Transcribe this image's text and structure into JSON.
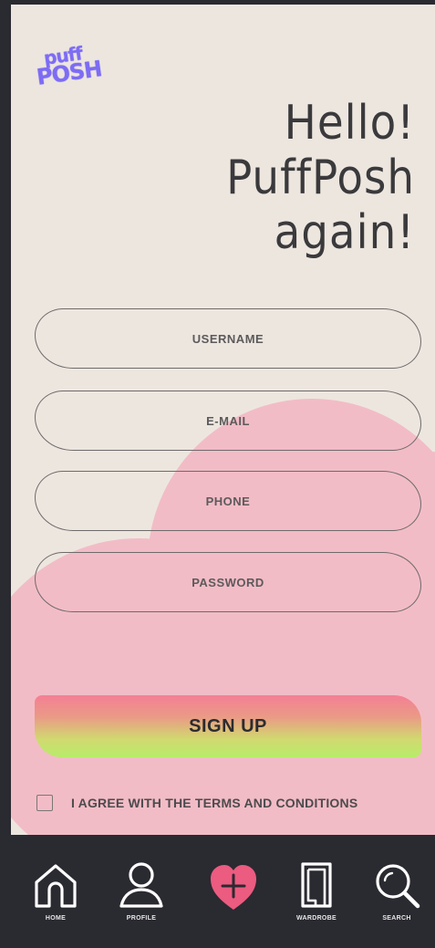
{
  "app": {
    "logo_line1": "puff",
    "logo_line2": "POSH"
  },
  "header": {
    "title_line1": "Hello!",
    "title_line2": "PuffPosh",
    "title_line3": "again!"
  },
  "form": {
    "username_placeholder": "USERNAME",
    "email_placeholder": "E-MAIL",
    "phone_placeholder": "PHONE",
    "password_placeholder": "PASSWORD",
    "submit_label": "SIGN UP",
    "terms_label": "I AGREE WITH THE TERMS AND CONDITIONS",
    "terms_checked": false
  },
  "nav": {
    "items": [
      {
        "label": "HOME",
        "icon": "home-icon"
      },
      {
        "label": "PROFILE",
        "icon": "profile-icon"
      },
      {
        "label": "",
        "icon": "add-heart-icon"
      },
      {
        "label": "WARDROBE",
        "icon": "wardrobe-icon"
      },
      {
        "label": "SEARCH",
        "icon": "search-icon"
      }
    ]
  },
  "colors": {
    "background": "#ede6df",
    "blob": "#f2bcc6",
    "accent_pink": "#ec5b80",
    "logo_purple": "#7d6cf4",
    "nav_bg": "#2a2a31"
  }
}
